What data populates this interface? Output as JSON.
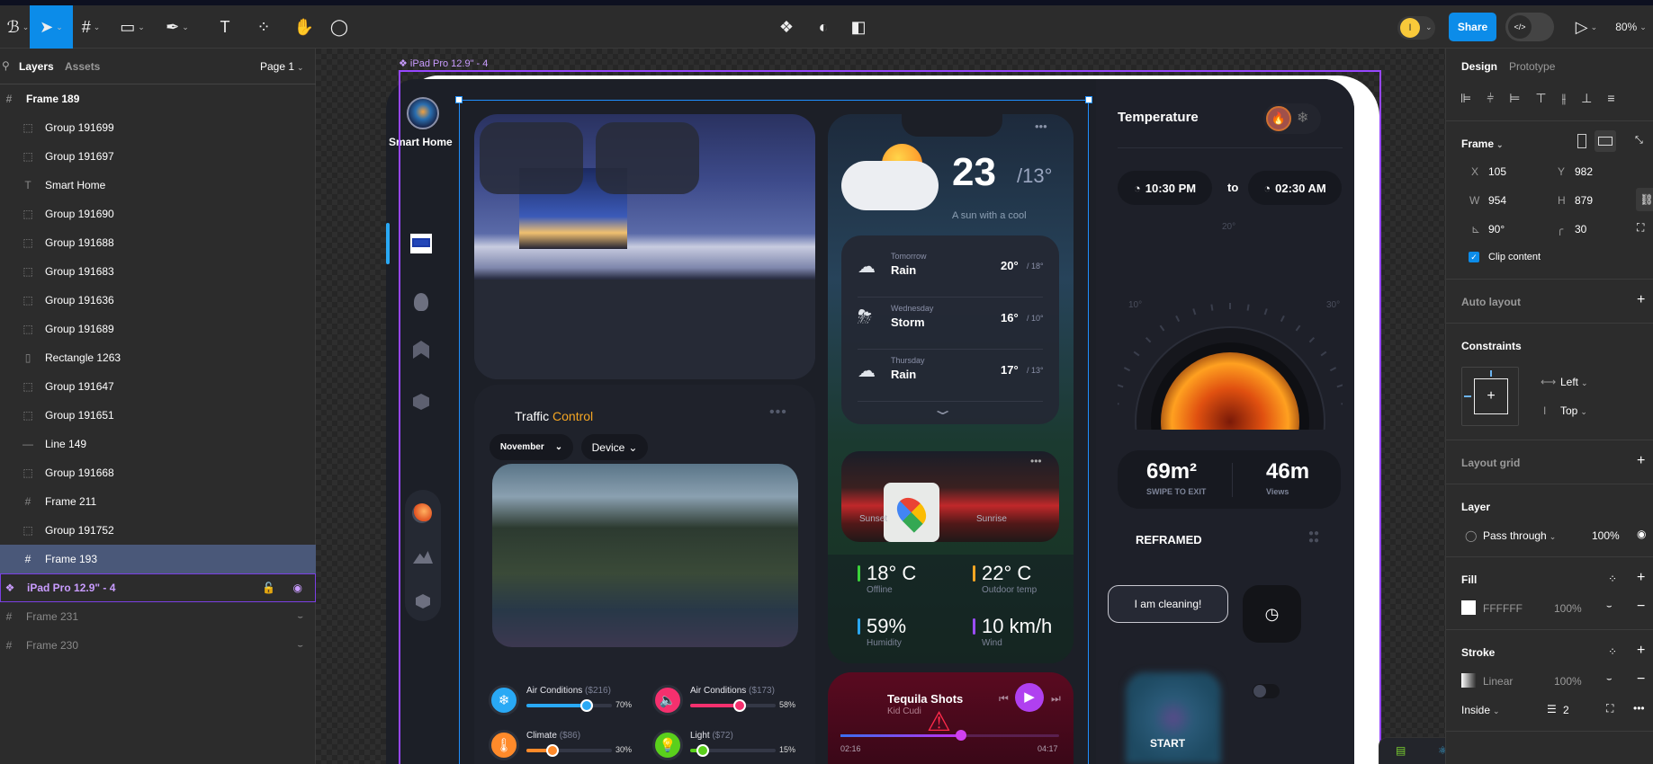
{
  "toolbar": {
    "tools": [
      {
        "name": "main-menu",
        "glyph": "ℬ"
      },
      {
        "name": "move-tool",
        "glyph": "➤",
        "active": true
      },
      {
        "name": "frame-tool",
        "glyph": "#"
      },
      {
        "name": "rectangle-tool",
        "glyph": "▭"
      },
      {
        "name": "pen-tool",
        "glyph": "✒"
      },
      {
        "name": "text-tool",
        "glyph": "T"
      },
      {
        "name": "resources-tool",
        "glyph": "⁘"
      },
      {
        "name": "hand-tool",
        "glyph": "✋"
      },
      {
        "name": "comment-tool",
        "glyph": "◯"
      }
    ],
    "center_tools": [
      {
        "name": "component-icon",
        "glyph": "❖"
      },
      {
        "name": "mask-icon",
        "glyph": "◐"
      },
      {
        "name": "boolean-icon",
        "glyph": "◧"
      }
    ],
    "avatar_initial": "I",
    "share_label": "Share",
    "dev_mode_glyph": "</>",
    "zoom": "80%",
    "accent": "#0c8ce9"
  },
  "layers_panel": {
    "tabs": [
      "Layers",
      "Assets"
    ],
    "page": "Page 1",
    "rows": [
      {
        "icon": "frame",
        "label": "Frame 189",
        "depth": 0,
        "bold": true
      },
      {
        "icon": "group",
        "label": "Group 191699",
        "depth": 1
      },
      {
        "icon": "group",
        "label": "Group 191697",
        "depth": 1
      },
      {
        "icon": "text",
        "label": "Smart Home",
        "depth": 1
      },
      {
        "icon": "group",
        "label": "Group 191690",
        "depth": 1
      },
      {
        "icon": "group",
        "label": "Group 191688",
        "depth": 1
      },
      {
        "icon": "group",
        "label": "Group 191683",
        "depth": 1
      },
      {
        "icon": "group",
        "label": "Group 191636",
        "depth": 1
      },
      {
        "icon": "group",
        "label": "Group 191689",
        "depth": 1
      },
      {
        "icon": "rectangle",
        "label": "Rectangle 1263",
        "depth": 1
      },
      {
        "icon": "group",
        "label": "Group 191647",
        "depth": 1
      },
      {
        "icon": "group",
        "label": "Group 191651",
        "depth": 1
      },
      {
        "icon": "line",
        "label": "Line 149",
        "depth": 1
      },
      {
        "icon": "group",
        "label": "Group 191668",
        "depth": 1
      },
      {
        "icon": "frame",
        "label": "Frame 211",
        "depth": 1
      },
      {
        "icon": "group",
        "label": "Group 191752",
        "depth": 1
      },
      {
        "icon": "frame",
        "label": "Frame 193",
        "depth": 1,
        "selected": true
      },
      {
        "icon": "component",
        "label": "iPad Pro 12.9\" - 4",
        "depth": 0,
        "component": true
      },
      {
        "icon": "frame",
        "label": "Frame 231",
        "depth": 0,
        "hidden": true
      },
      {
        "icon": "frame",
        "label": "Frame 230",
        "depth": 0,
        "hidden": true
      }
    ]
  },
  "canvas": {
    "frame_label": "iPad Pro 12.9\" - 4",
    "app": {
      "brand": "Smart Home",
      "traffic": {
        "title_a": "Traffic",
        "title_b": "Control",
        "month": "November",
        "device": "Device",
        "devices": [
          {
            "label": "Air Conditions",
            "price": "($216)",
            "percent": 70,
            "text": "70%",
            "color": "#29a9f5",
            "icon": "air-conditioner-icon",
            "glyph": "❄"
          },
          {
            "label": "Air Conditions",
            "price": "($173)",
            "percent": 58,
            "text": "58%",
            "color": "#f5306e",
            "icon": "speaker-icon",
            "glyph": "🔈"
          },
          {
            "label": "Climate",
            "price": "($86)",
            "percent": 30,
            "text": "30%",
            "color": "#ff8a2a",
            "icon": "thermometer-icon",
            "glyph": "🌡"
          },
          {
            "label": "Light",
            "price": "($72)",
            "percent": 15,
            "text": "15%",
            "color": "#5ad01c",
            "icon": "lightbulb-icon",
            "glyph": "💡"
          }
        ]
      },
      "weather": {
        "temp": "23",
        "low": "/13°",
        "caption": "A sun with a cool",
        "forecast": [
          {
            "day": "Tomorrow",
            "cond": "Rain",
            "hi": "20°",
            "lo": "/ 18°"
          },
          {
            "day": "Wednesday",
            "cond": "Storm",
            "hi": "16°",
            "lo": "/ 10°"
          },
          {
            "day": "Thursday",
            "cond": "Rain",
            "hi": "17°",
            "lo": "/ 13°"
          }
        ],
        "sunset": "Sunset",
        "sunrise": "Sunrise",
        "stats": [
          {
            "value": "18° C",
            "label": "Offline",
            "color": "#3bd13b"
          },
          {
            "value": "22° C",
            "label": "Outdoor temp",
            "color": "#f5a623"
          },
          {
            "value": "59%",
            "label": "Humidity",
            "color": "#2aa7f0"
          },
          {
            "value": "10 km/h",
            "label": "Wind",
            "color": "#9b4dff"
          }
        ]
      },
      "music": {
        "title": "Tequila Shots",
        "artist": "Kid Cudi",
        "elapsed": "02:16",
        "total": "04:17",
        "progress": 0.55
      },
      "temperature": {
        "title": "Temperature",
        "from": "10:30 PM",
        "to_label": "to",
        "to": "02:30 AM",
        "ticks": [
          "10°",
          "20°",
          "30°"
        ],
        "area": "69m²",
        "area_label": "SWIPE TO EXIT",
        "views": "46m",
        "views_label": "Views",
        "reframed": "REFRAMED",
        "cleaning": "I am cleaning!",
        "start": "START"
      }
    }
  },
  "properties": {
    "tabs": [
      "Design",
      "Prototype"
    ],
    "frame_label": "Frame",
    "x": "105",
    "y": "982",
    "w": "954",
    "h": "879",
    "rotation": "90°",
    "radius": "30",
    "clip_content": "Clip content",
    "clip_checked": true,
    "auto_layout": "Auto layout",
    "constraints": "Constraints",
    "h_constraint": "Left",
    "v_constraint": "Top",
    "layout_grid": "Layout grid",
    "layer": "Layer",
    "blend": "Pass through",
    "layer_opacity": "100%",
    "fill": "Fill",
    "fill_hex": "FFFFFF",
    "fill_opacity": "100%",
    "stroke": "Stroke",
    "stroke_type": "Linear",
    "stroke_opacity": "100%",
    "stroke_position": "Inside",
    "stroke_weight": "2"
  }
}
